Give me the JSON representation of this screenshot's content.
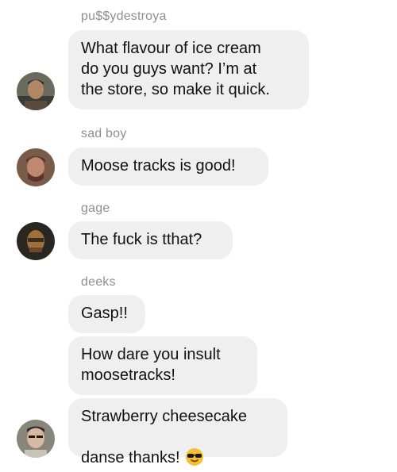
{
  "messages": [
    {
      "sender": "pu$$ydestroya",
      "text": "What flavour of ice cream\ndo you guys want? I’m at\nthe store, so make it quick."
    },
    {
      "sender": "sad boy",
      "text": "Moose tracks is good!"
    },
    {
      "sender": "gage",
      "text": "The fuck is tthat?"
    },
    {
      "sender": "deeks",
      "text": "Gasp!!"
    },
    {
      "text": "How dare you insult\nmoosetracks!"
    },
    {
      "text": "Strawberry cheesecake\ndanse thanks!",
      "emoji": "sunglasses-emoji"
    }
  ],
  "avatars": [
    {
      "name": "pu$$ydestroya-avatar"
    },
    {
      "name": "sad-boy-avatar"
    },
    {
      "name": "gage-avatar"
    },
    {
      "name": "danse-avatar"
    }
  ],
  "colors": {
    "bubble": "#efeff0",
    "sender_label": "#8e8e93",
    "background": "#ffffff"
  }
}
